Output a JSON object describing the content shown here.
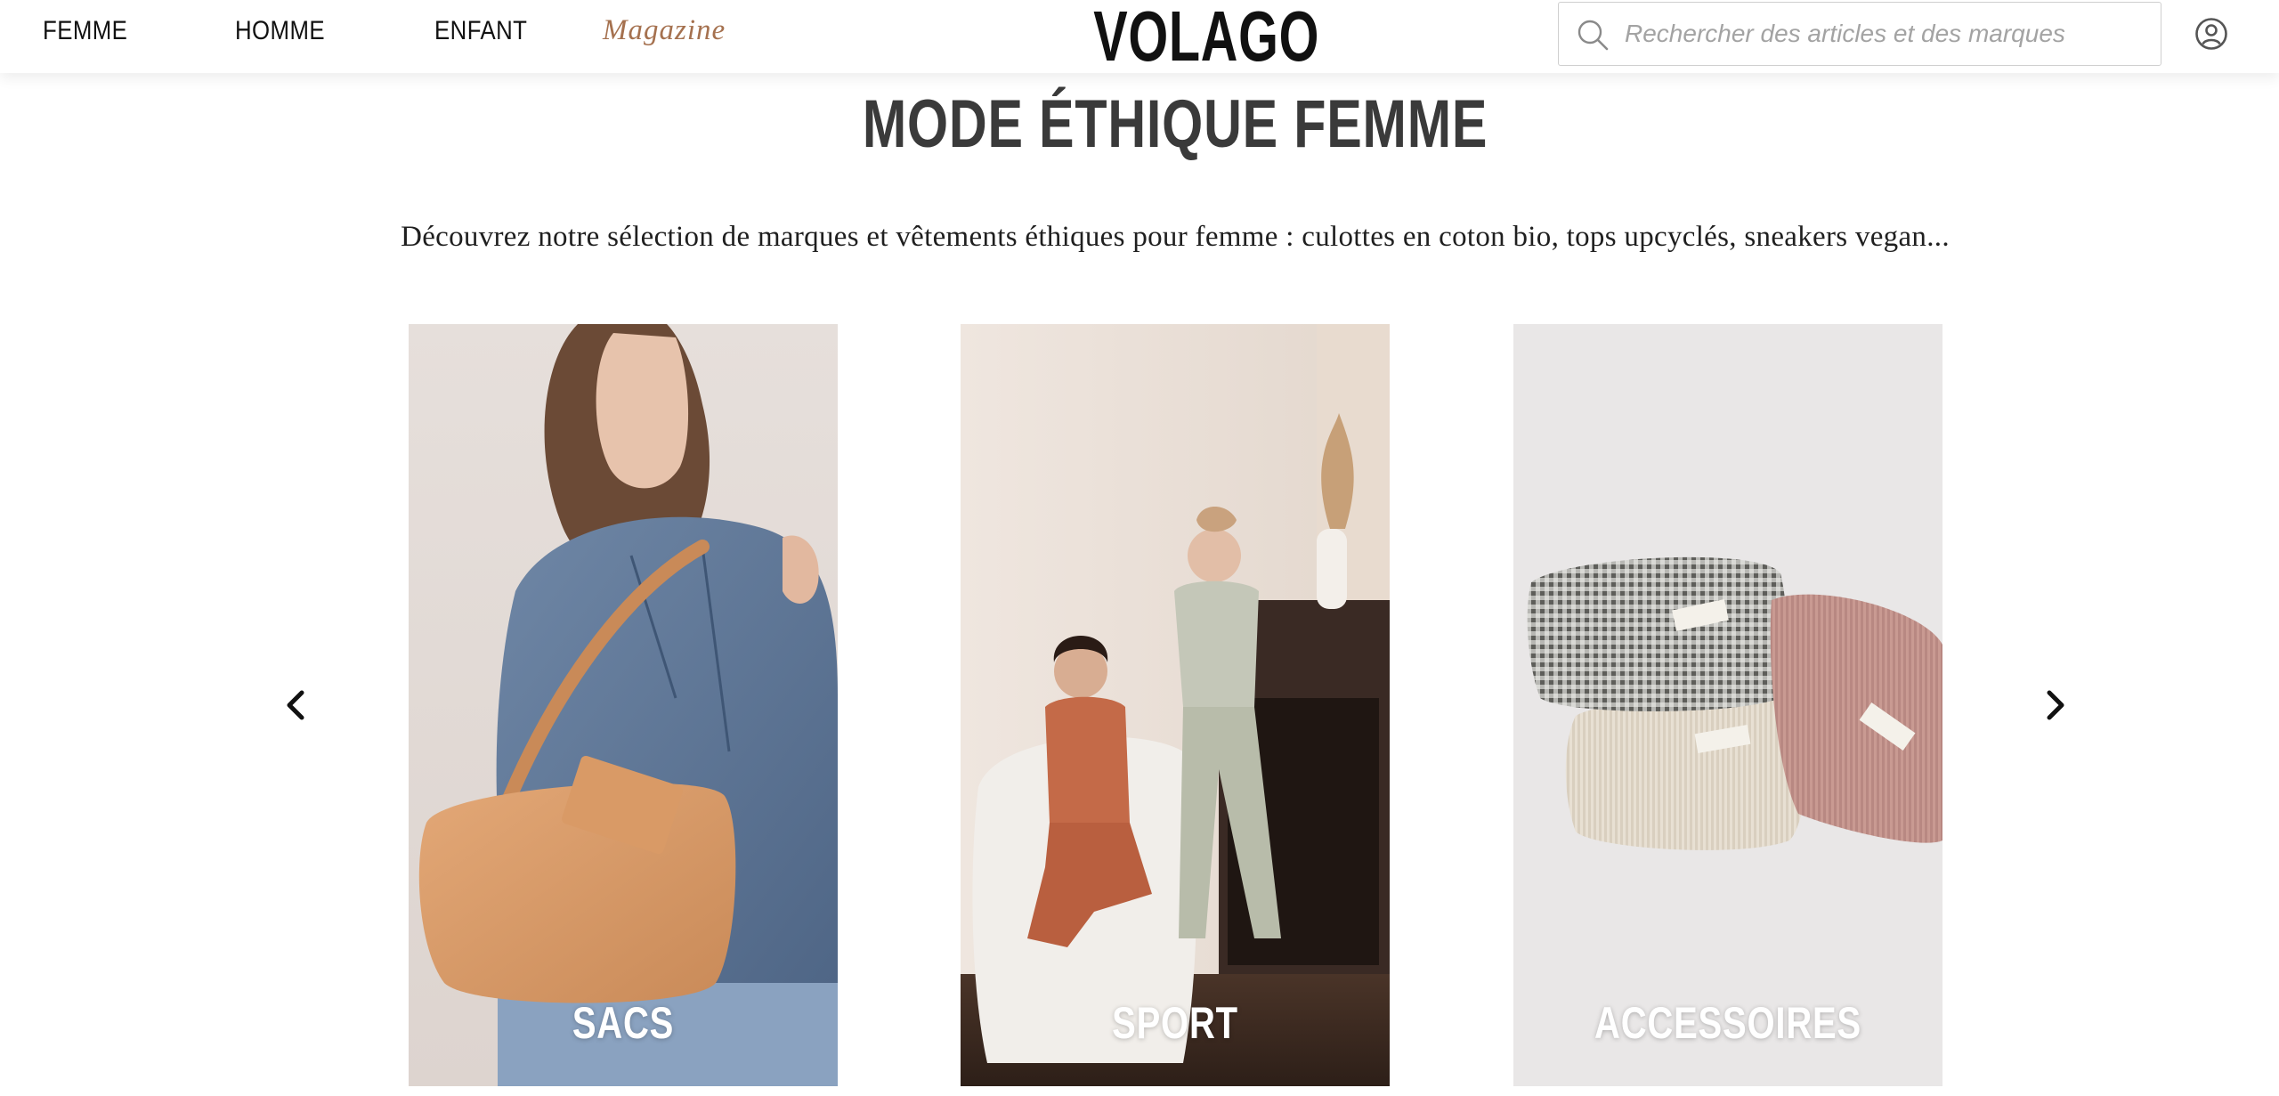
{
  "header": {
    "nav": {
      "femme": "FEMME",
      "homme": "HOMME",
      "enfant": "ENFANT",
      "magazine": "Magazine"
    },
    "logo": "VOLAGO",
    "search": {
      "placeholder": "Rechercher des articles et des marques",
      "value": "",
      "icon": "search-icon"
    },
    "account_icon": "account-icon"
  },
  "main": {
    "title": "MODE ÉTHIQUE FEMME",
    "description": "Découvrez notre sélection de marques et vêtements éthiques pour femme : culottes en coton bio, tops upcyclés, sneakers vegan..."
  },
  "carousel": {
    "prev_icon": "chevron-left-icon",
    "next_icon": "chevron-right-icon",
    "cards": [
      {
        "label": "SACS"
      },
      {
        "label": "SPORT"
      },
      {
        "label": "ACCESSOIRES"
      }
    ]
  },
  "colors": {
    "accent_magazine": "#a5714f",
    "title_text": "#3a3a3a",
    "nav_text": "#111111"
  }
}
